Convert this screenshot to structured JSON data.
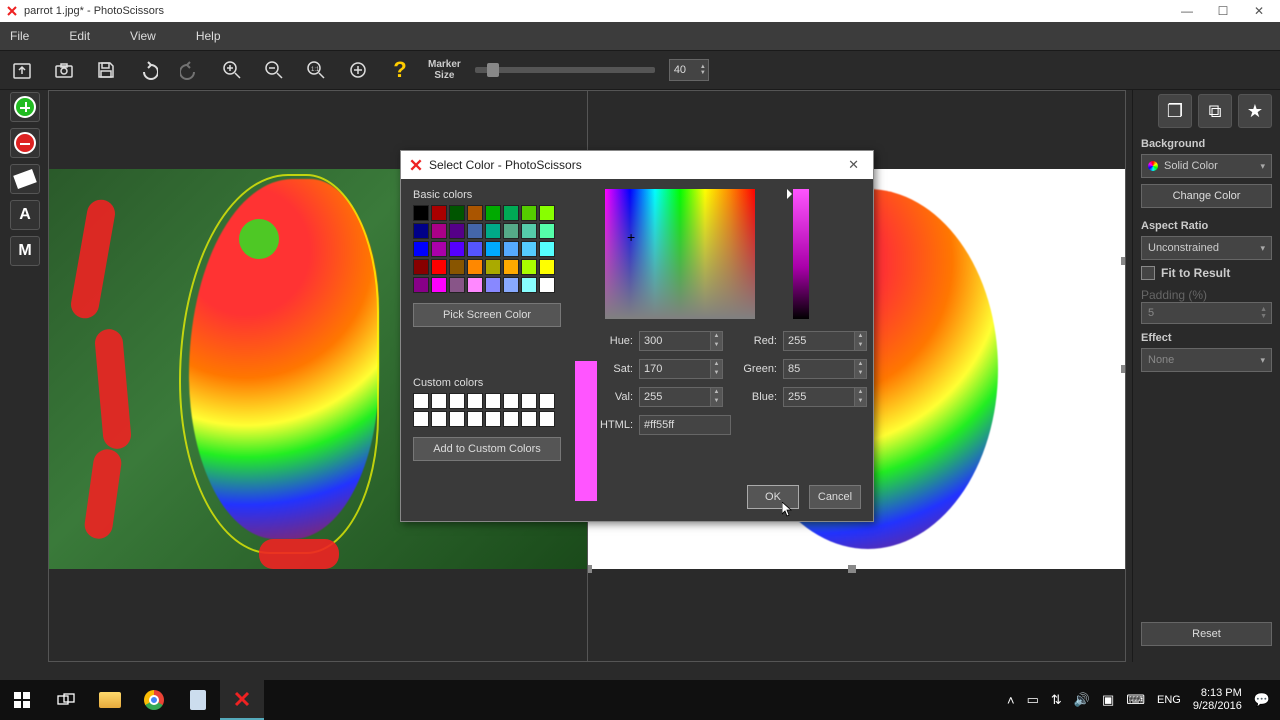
{
  "titlebar": {
    "title": "parrot 1.jpg* - PhotoScissors"
  },
  "menu": {
    "file": "File",
    "edit": "Edit",
    "view": "View",
    "help": "Help"
  },
  "toolbar": {
    "marker_label1": "Marker",
    "marker_label2": "Size",
    "marker_value": "40"
  },
  "right": {
    "background_title": "Background",
    "bg_option": "Solid Color",
    "change_color": "Change Color",
    "aspect_title": "Aspect Ratio",
    "aspect_option": "Unconstrained",
    "fit": "Fit to Result",
    "padding_label": "Padding (%)",
    "padding_value": "5",
    "effect_title": "Effect",
    "effect_option": "None",
    "reset": "Reset"
  },
  "dialog": {
    "title": "Select Color - PhotoScissors",
    "basic": "Basic colors",
    "pick": "Pick Screen Color",
    "custom": "Custom colors",
    "add_custom": "Add to Custom Colors",
    "hue_l": "Hue:",
    "hue_v": "300",
    "sat_l": "Sat:",
    "sat_v": "170",
    "val_l": "Val:",
    "val_v": "255",
    "red_l": "Red:",
    "red_v": "255",
    "green_l": "Green:",
    "green_v": "85",
    "blue_l": "Blue:",
    "blue_v": "255",
    "html_l": "HTML:",
    "html_v": "#ff55ff",
    "ok": "OK",
    "cancel": "Cancel"
  },
  "basic_colors": [
    "#000000",
    "#aa0000",
    "#005500",
    "#aa5500",
    "#00aa00",
    "#00aa55",
    "#55cc00",
    "#88ff00",
    "#000088",
    "#aa0088",
    "#550088",
    "#4466aa",
    "#00aa88",
    "#55aa88",
    "#55ccaa",
    "#55ffaa",
    "#0000ff",
    "#aa00aa",
    "#5500ff",
    "#5555ff",
    "#00aaff",
    "#55aaff",
    "#55ccff",
    "#55ffff",
    "#880000",
    "#ff0000",
    "#885500",
    "#ff8800",
    "#aaaa00",
    "#ffaa00",
    "#aaff00",
    "#ffff00",
    "#880088",
    "#ff00ff",
    "#885588",
    "#ff88ff",
    "#8888ff",
    "#88aaff",
    "#88ffff",
    "#ffffff"
  ],
  "taskbar": {
    "lang": "ENG",
    "time": "8:13 PM",
    "date": "9/28/2016"
  }
}
